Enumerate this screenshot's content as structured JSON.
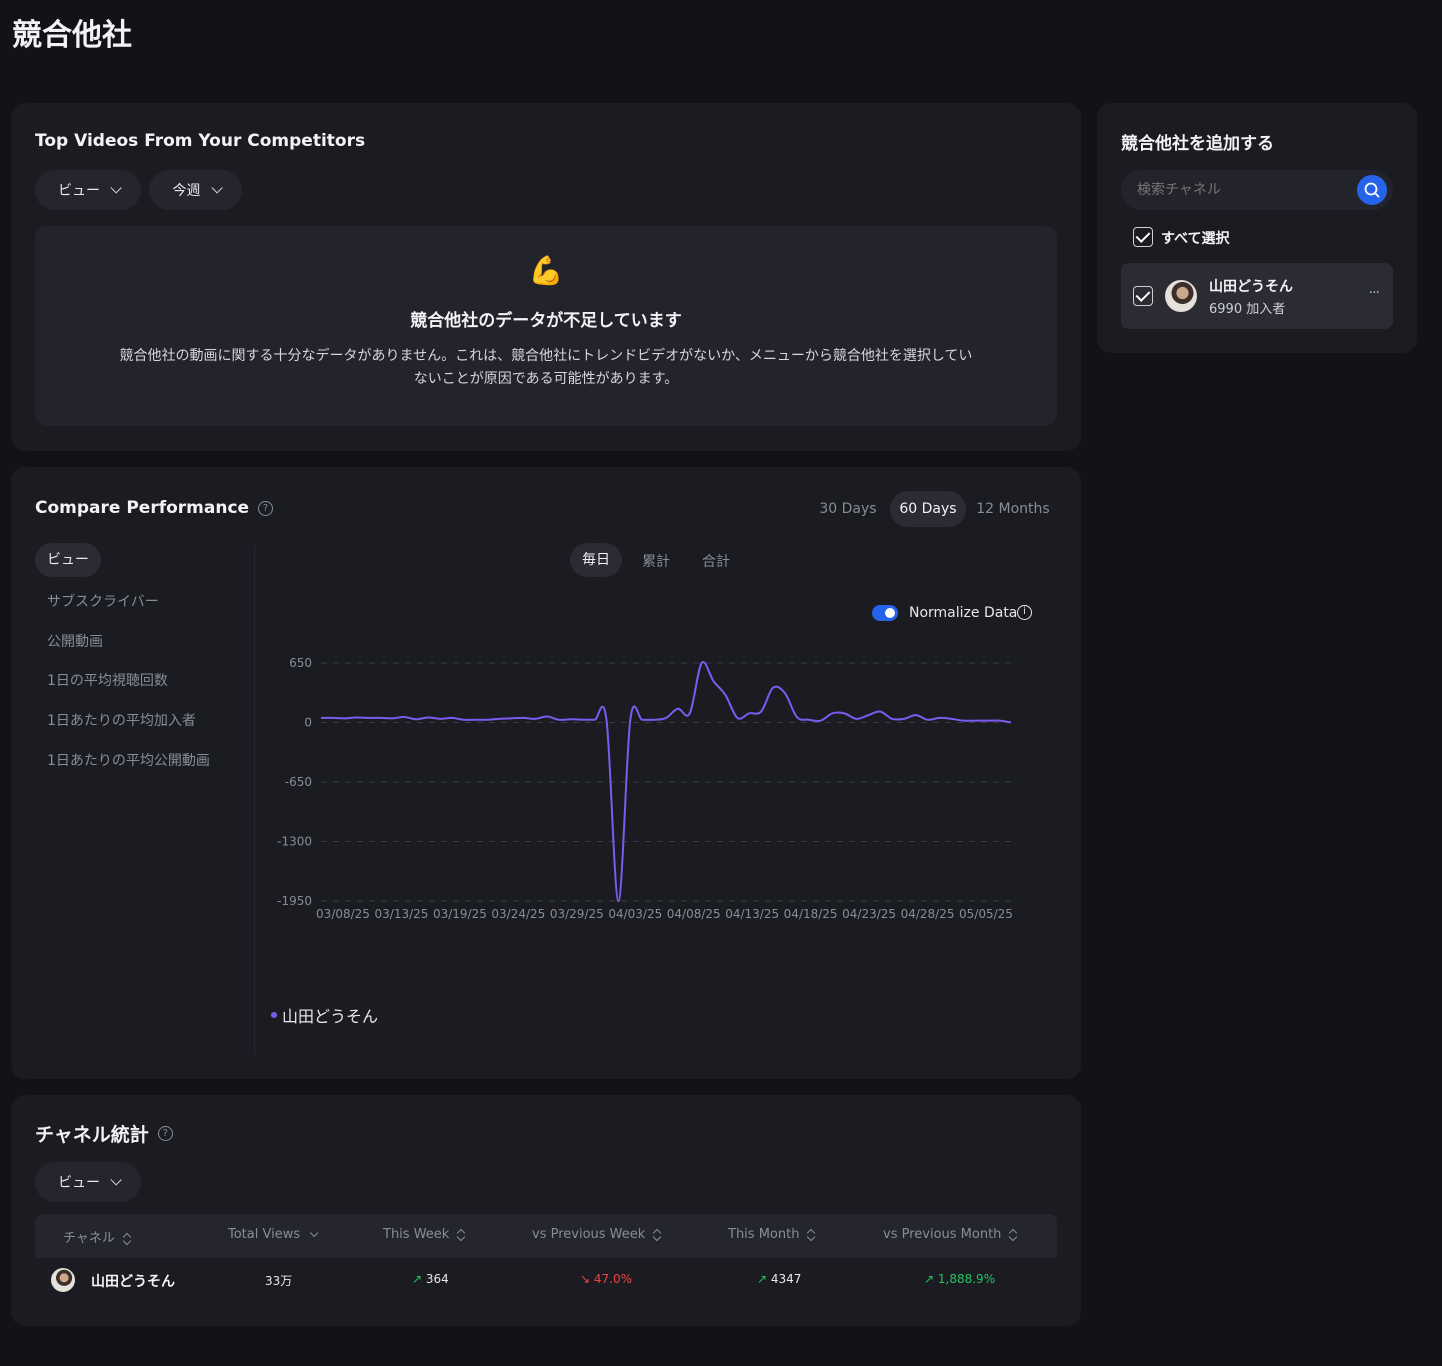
{
  "page": {
    "title": "競合他社"
  },
  "top_videos": {
    "title": "Top Videos From Your Competitors",
    "metric_dropdown": "ビュー",
    "period_dropdown": "今週",
    "empty_emoji": "💪",
    "empty_title": "競合他社のデータが不足しています",
    "empty_line1": "競合他社の動画に関する十分なデータがありません。これは、競合他社にトレンドビデオがないか、メニューから競合他社を選択してい",
    "empty_line2": "ないことが原因である可能性があります。"
  },
  "add_competitor": {
    "title": "競合他社を追加する",
    "search_placeholder": "検索チャネル",
    "select_all": "すべて選択",
    "channel": {
      "name": "山田どうそん",
      "subscribers": "6990 加入者",
      "more": "···"
    }
  },
  "compare": {
    "title": "Compare Performance",
    "help_icon": "?",
    "ranges": [
      "30 Days",
      "60 Days",
      "12 Months"
    ],
    "active_range": "60 Days",
    "metrics": [
      "ビュー",
      "サブスクライバー",
      "公開動画",
      "1日の平均視聴回数",
      "1日あたりの平均加入者",
      "1日あたりの平均公開動画"
    ],
    "active_metric": "ビュー",
    "modes": [
      "毎日",
      "累計",
      "合計"
    ],
    "active_mode": "毎日",
    "normalize_label": "Normalize Data",
    "normalize_on": true,
    "info_icon": "i",
    "accent_color": "#2563eb",
    "line_color": "#7b5cf0"
  },
  "chart_data": {
    "type": "line",
    "yticks": [
      650,
      0,
      -650,
      -1300,
      -1950
    ],
    "ylim": [
      -1950,
      650
    ],
    "xticks": [
      "03/08/25",
      "03/13/25",
      "03/19/25",
      "03/24/25",
      "03/29/25",
      "04/03/25",
      "04/08/25",
      "04/13/25",
      "04/18/25",
      "04/23/25",
      "04/28/25",
      "05/05/25"
    ],
    "series": [
      {
        "name": "山田どうそん",
        "x": [
          "03/08/25",
          "03/09/25",
          "03/10/25",
          "03/11/25",
          "03/12/25",
          "03/13/25",
          "03/14/25",
          "03/15/25",
          "03/16/25",
          "03/17/25",
          "03/18/25",
          "03/19/25",
          "03/20/25",
          "03/21/25",
          "03/22/25",
          "03/23/25",
          "03/24/25",
          "03/25/25",
          "03/26/25",
          "03/27/25",
          "03/28/25",
          "03/29/25",
          "03/30/25",
          "03/31/25",
          "04/01/25",
          "04/02/25",
          "04/03/25",
          "04/04/25",
          "04/05/25",
          "04/06/25",
          "04/07/25",
          "04/08/25",
          "04/09/25",
          "04/10/25",
          "04/11/25",
          "04/12/25",
          "04/13/25",
          "04/14/25",
          "04/15/25",
          "04/16/25",
          "04/17/25",
          "04/18/25",
          "04/19/25",
          "04/20/25",
          "04/21/25",
          "04/22/25",
          "04/23/25",
          "04/24/25",
          "04/25/25",
          "04/26/25",
          "04/27/25",
          "04/28/25",
          "04/29/25",
          "04/30/25",
          "05/01/25",
          "05/02/25",
          "05/03/25",
          "05/04/25",
          "05/05/25"
        ],
        "y": [
          50,
          50,
          45,
          55,
          50,
          50,
          45,
          60,
          35,
          55,
          40,
          50,
          30,
          30,
          30,
          40,
          45,
          50,
          40,
          65,
          30,
          35,
          30,
          30,
          25,
          -1950,
          30,
          30,
          30,
          50,
          150,
          100,
          650,
          450,
          300,
          50,
          100,
          120,
          380,
          320,
          60,
          30,
          20,
          100,
          100,
          40,
          80,
          120,
          40,
          40,
          80,
          30,
          50,
          40,
          20,
          20,
          20,
          20,
          0
        ]
      }
    ]
  },
  "legend": {
    "series_name": "山田どうそん"
  },
  "channel_stats": {
    "title": "チャネル統計",
    "help_icon": "?",
    "metric_dropdown": "ビュー",
    "columns": [
      "チャネル",
      "Total Views",
      "This Week",
      "vs Previous Week",
      "This Month",
      "vs Previous Month"
    ],
    "rows": [
      {
        "channel": "山田どうそん",
        "total_views": "33万",
        "this_week": "364",
        "vs_prev_week": "47.0%",
        "this_month": "4347",
        "vs_prev_month": "1,888.9%"
      }
    ],
    "up_color": "#22c55e",
    "down_color": "#ef4444"
  }
}
